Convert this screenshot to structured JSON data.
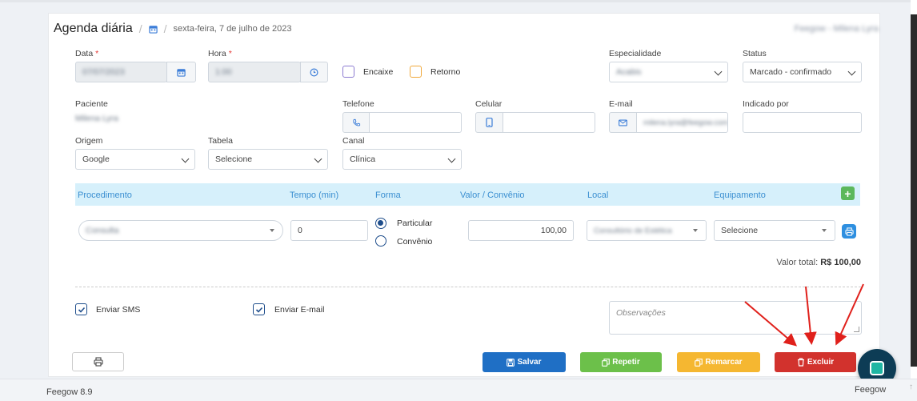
{
  "header": {
    "title": "Agenda diária",
    "date": "sexta-feira, 7 de julho de 2023",
    "user": "Feegow - Milena Lyra"
  },
  "form": {
    "data_label": "Data",
    "data_value": "07/07/2023",
    "hora_label": "Hora",
    "hora_value": "1:00",
    "encaixe_label": "Encaixe",
    "retorno_label": "Retorno",
    "especialidade_label": "Especialidade",
    "especialidade_value": "Acabis",
    "status_label": "Status",
    "status_value": "Marcado - confirmado",
    "paciente_label": "Paciente",
    "paciente_value": "Milena Lyra",
    "telefone_label": "Telefone",
    "celular_label": "Celular",
    "email_label": "E-mail",
    "email_value": "milena.lyra@feegow.com",
    "indicado_label": "Indicado por",
    "origem_label": "Origem",
    "origem_value": "Google",
    "tabela_label": "Tabela",
    "tabela_value": "Selecione",
    "canal_label": "Canal",
    "canal_value": "Clínica"
  },
  "procedures": {
    "headers": [
      "Procedimento",
      "Tempo (min)",
      "Forma",
      "Valor / Convênio",
      "Local",
      "Equipamento"
    ],
    "row": {
      "procedimento": "Consulta",
      "tempo": "0",
      "forma_options": [
        "Particular",
        "Convênio"
      ],
      "forma_selected": "Particular",
      "valor": "100,00",
      "local": "Consultório de Estética",
      "equipamento": "Selecione"
    },
    "total_label": "Valor total:",
    "total_value": "R$ 100,00"
  },
  "notify": {
    "sms_label": "Enviar SMS",
    "email_label": "Enviar E-mail",
    "observacoes_placeholder": "Observações"
  },
  "buttons": {
    "salvar": "Salvar",
    "repetir": "Repetir",
    "remarcar": "Remarcar",
    "excluir": "Excluir"
  },
  "colors": {
    "salvar": "#1f6fc5",
    "repetir": "#6cc04a",
    "remarcar": "#f5b731",
    "excluir": "#d2322d",
    "annotation_arrows": "#e0201b"
  },
  "footer": {
    "version": "Feegow 8.9",
    "brand": "Feegow"
  }
}
